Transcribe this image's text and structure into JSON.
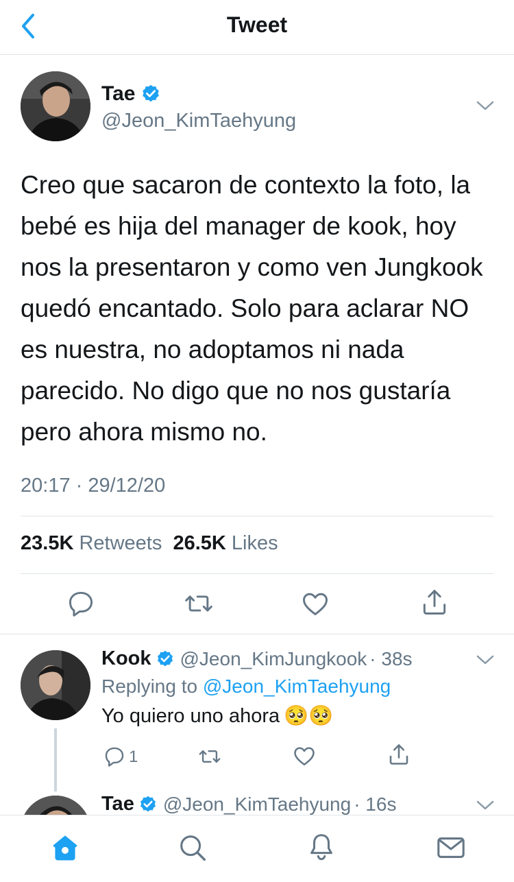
{
  "header": {
    "title": "Tweet"
  },
  "tweet": {
    "author_name": "Tae",
    "author_handle": "@Jeon_KimTaehyung",
    "text": "Creo que sacaron de contexto la foto, la bebé es hija del manager de kook, hoy nos la presentaron y como ven Jungkook quedó encantado. Solo para aclarar NO es nuestra, no adoptamos ni nada parecido. No digo que no nos gustaría pero ahora mismo no.",
    "timestamp": "20:17 · 29/12/20",
    "retweets_count": "23.5K",
    "retweets_label": "Retweets",
    "likes_count": "26.5K",
    "likes_label": "Likes"
  },
  "reply": {
    "author_name": "Kook",
    "author_handle": "@Jeon_KimJungkook",
    "time": "· 38s",
    "replying_prefix": "Replying to",
    "replying_to": "@Jeon_KimTaehyung",
    "text": "Yo quiero uno ahora",
    "emoji": "🥺🥺",
    "reply_count": "1"
  },
  "next_reply": {
    "author_name": "Tae",
    "author_handle": "@Jeon_KimTaehyung",
    "time": "· 16s"
  },
  "colors": {
    "accent": "#1da1f2",
    "secondary_text": "#657786",
    "divider": "#dfe3e7"
  },
  "icons": [
    "back-chevron-icon",
    "verified-badge-icon",
    "chevron-down-icon",
    "reply-icon",
    "retweet-icon",
    "like-icon",
    "share-icon",
    "home-icon",
    "search-icon",
    "notifications-icon",
    "messages-icon"
  ]
}
